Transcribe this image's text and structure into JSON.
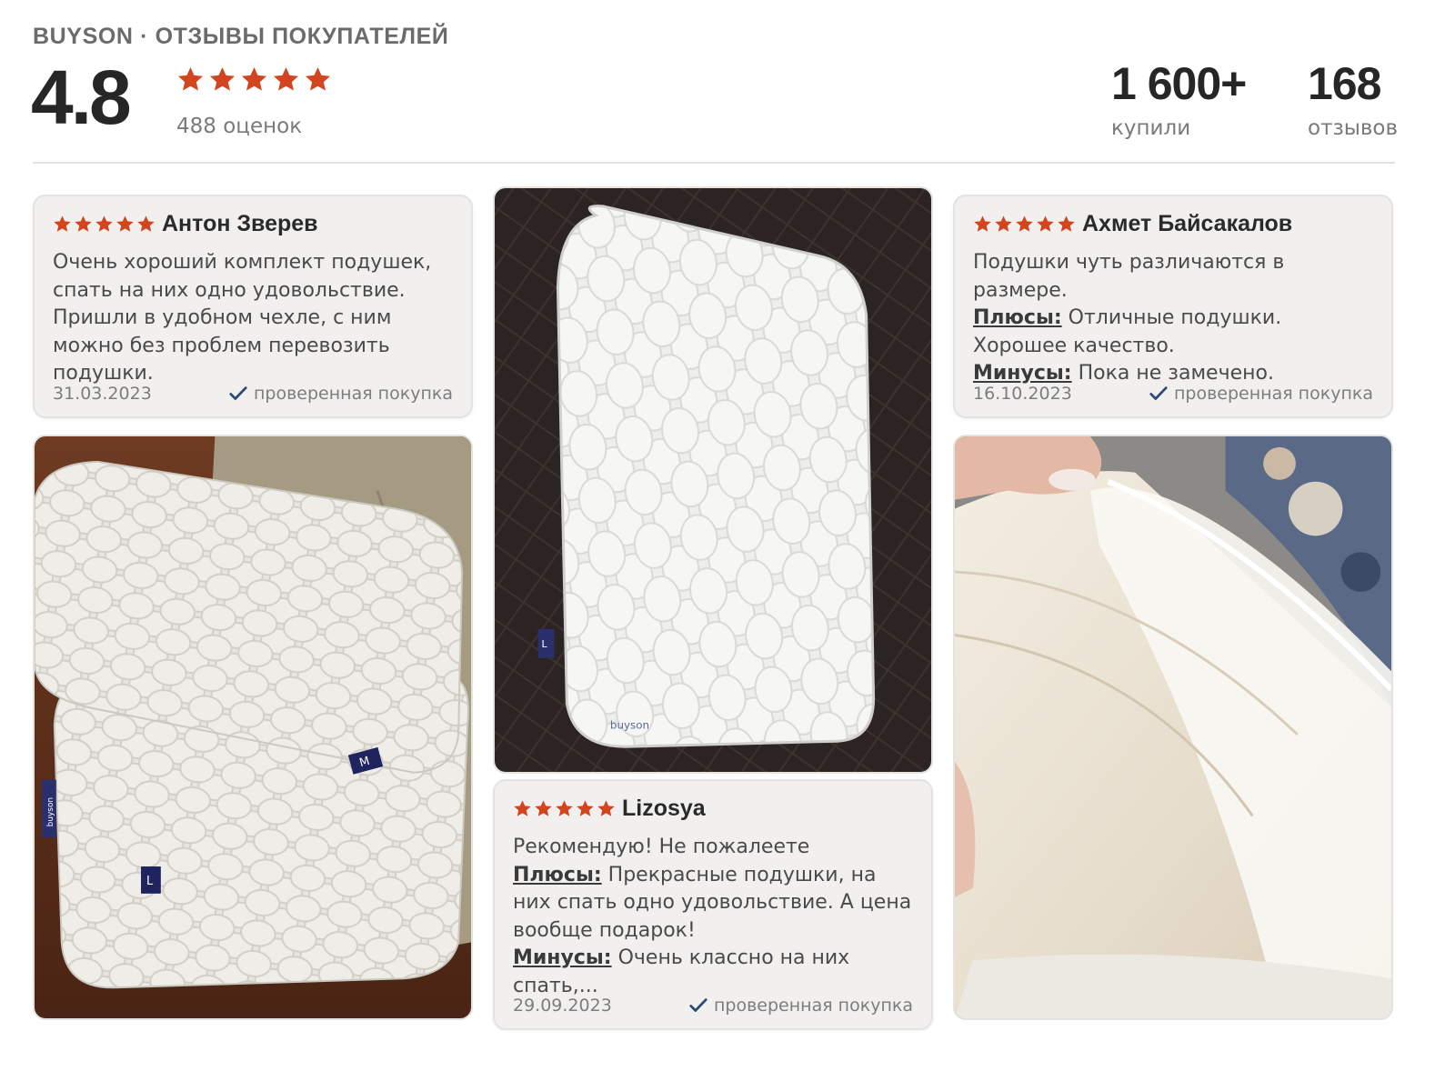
{
  "header": {
    "title": "BUYSON · ОТЗЫВЫ ПОКУПАТЕЛЕЙ",
    "rating": "4.8",
    "stars": 5,
    "ratings_count": "488 оценок",
    "bought_value": "1 600+",
    "bought_label": "купили",
    "reviews_value": "168",
    "reviews_label": "отзывов"
  },
  "colors": {
    "star": "#d2451e",
    "check": "#2b4a78",
    "card_bg": "#f1f0ee"
  },
  "reviews": [
    {
      "author": "Антон Зверев",
      "stars": 5,
      "text": "Очень хороший комплект подушек, спать на них одно удовольствие. Пришли в удобном чехле, с ним можно без проблем перевозить подушки.",
      "date": "31.03.2023",
      "verified": "проверенная покупка"
    },
    {
      "author": "Lizosya",
      "stars": 5,
      "text": "Рекомендую! Не пожалеете",
      "pros_label": "Плюсы:",
      "pros": "Прекрасные подушки, на них спать одно удовольствие. А цена вообще подарок!",
      "cons_label": "Минусы:",
      "cons": "Очень классно на них спать,...",
      "date": "29.09.2023",
      "verified": "проверенная покупка"
    },
    {
      "author": "Ахмет Байсакалов",
      "stars": 5,
      "text": "Подушки чуть различаются в размере.",
      "pros_label": "Плюсы:",
      "pros": "Отличные подушки. Хорошее качество.",
      "cons_label": "Минусы:",
      "cons": "Пока не замечено.",
      "date": "16.10.2023",
      "verified": "проверенная покупка"
    }
  ],
  "photos": {
    "p1_tag_m": "M",
    "p1_tag_l": "L",
    "p1_side_label": "buyson",
    "p2_tag": "L",
    "p2_label": "buyson"
  }
}
